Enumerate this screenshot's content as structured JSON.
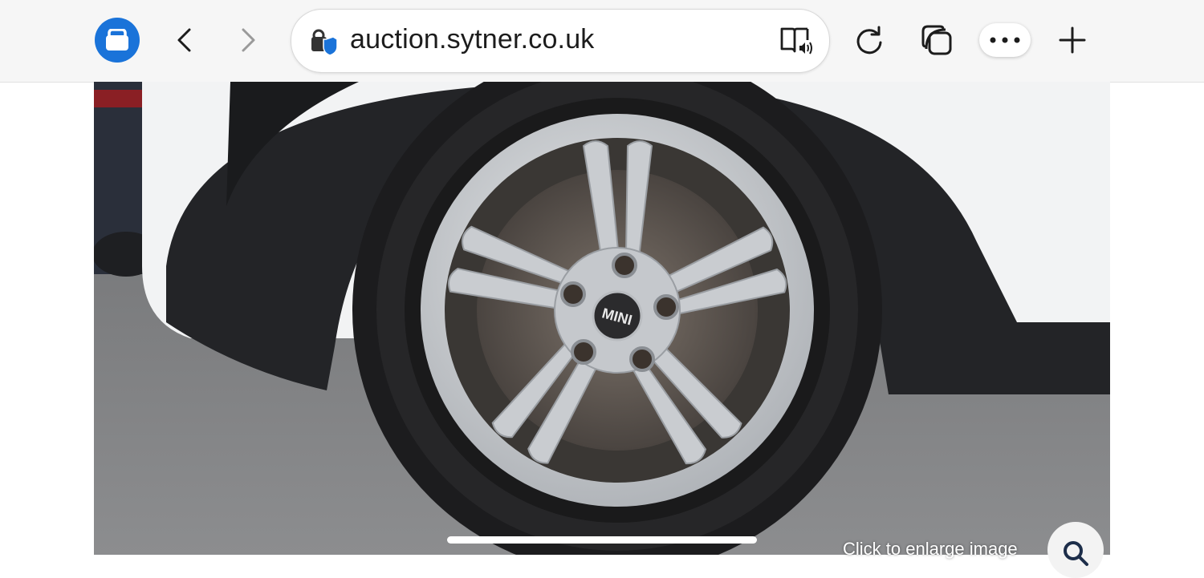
{
  "browser": {
    "url": "auction.sytner.co.uk",
    "icons": {
      "profile": "briefcase-icon",
      "back": "chevron-left-icon",
      "forward": "chevron-right-icon",
      "site_info": "lock-shield-icon",
      "reader": "read-aloud-icon",
      "refresh": "refresh-icon",
      "tabs": "tabs-icon",
      "more": "more-dots-icon",
      "new_tab": "plus-icon"
    },
    "colors": {
      "profile": "#1a73d9",
      "shield": "#1a73d9"
    }
  },
  "gallery": {
    "caption": "Click to enlarge image",
    "zoom_icon": "magnifier-icon",
    "wheel_badge_text": "MINI"
  }
}
